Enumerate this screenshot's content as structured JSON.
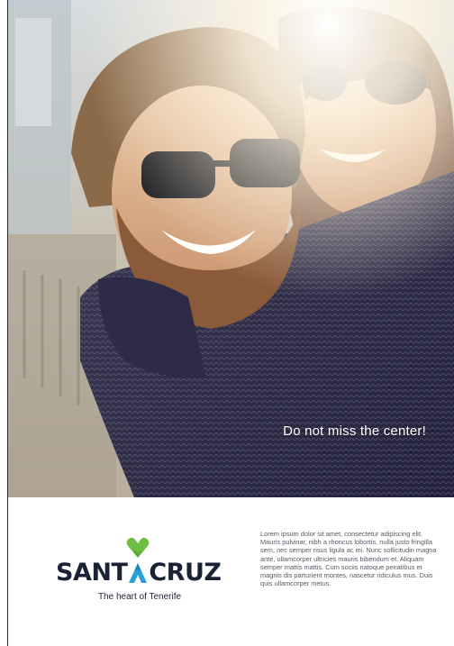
{
  "hero": {
    "caption": "Do not miss the center!"
  },
  "brand": {
    "word_left": "SANT",
    "word_right": "CRUZ",
    "tagline": "The heart of Tenerife",
    "colors": {
      "heart": "#6fbe44",
      "peak": "#2a9fd8",
      "text": "#1b2233"
    }
  },
  "body": {
    "text": "Lorem ipsum dolor sit amet, consectetur adipiscing elit. Mauris pulvinar, nibh a rhoncus lobortis, nulla justo fringilla sem, nec semper risus ligula ac mi. Nunc sollicitudin magna ante, ullamcorper ultricies mauris bibendum et. Aliquam semper mattis mattis. Cum sociis natoque penatibus et magnis dis parturient montes, nascetur ridiculus mus. Duis quis ullamcorper metus."
  }
}
